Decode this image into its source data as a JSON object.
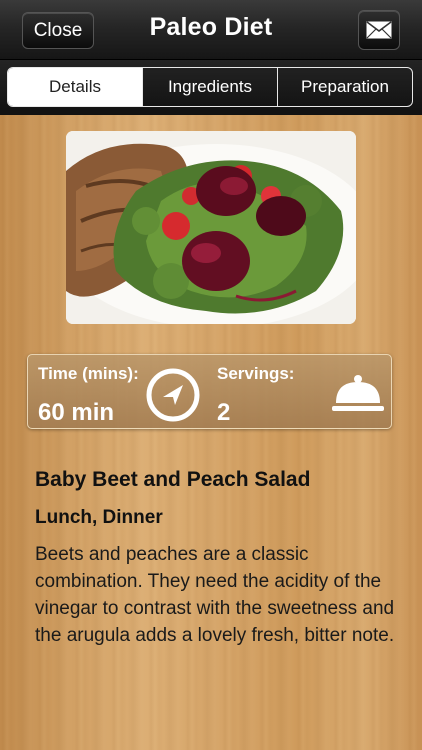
{
  "header": {
    "close_label": "Close",
    "title": "Paleo Diet",
    "mail_icon": "envelope-icon"
  },
  "tabs": [
    {
      "label": "Details",
      "active": true
    },
    {
      "label": "Ingredients",
      "active": false
    },
    {
      "label": "Preparation",
      "active": false
    }
  ],
  "info": {
    "time_label": "Time (mins):",
    "time_value": "60 min",
    "time_icon": "compass-icon",
    "servings_label": "Servings:",
    "servings_value": "2",
    "servings_icon": "serving-cloche-icon"
  },
  "recipe": {
    "title": "Baby Beet and Peach Salad",
    "meals": "Lunch, Dinner",
    "description": "Beets and peaches are a classic combination. They need the acidity of the vinegar to contrast with the sweetness and the arugula adds a lovely fresh, bitter note."
  },
  "colors": {
    "header_bg": "#1e1e1e",
    "accent_text": "#ffffff",
    "body_text": "#111111",
    "wood": "#d2a165"
  }
}
